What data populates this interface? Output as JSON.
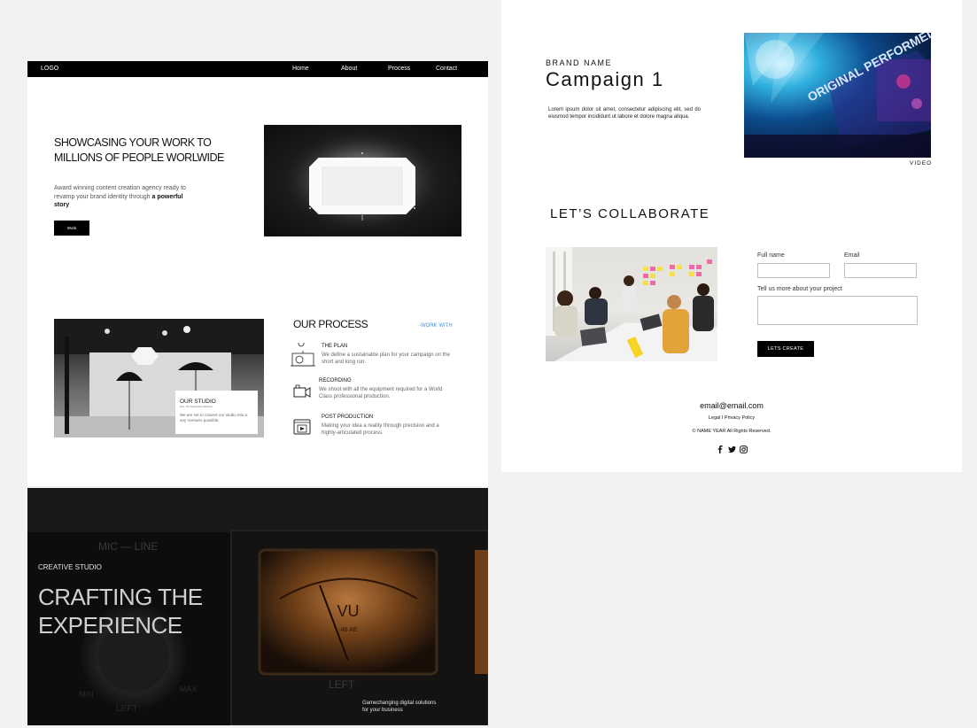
{
  "left_page": {
    "nav": {
      "logo": "LOGO",
      "items": [
        "Home",
        "About",
        "Process",
        "Contact"
      ]
    },
    "hero": {
      "title": "SHOWCASING YOUR WORK TO MILLIONS OF PEOPLE WORLWIDE",
      "desc_plain": "Award winning content creation agency ready to revamp your brand identity through",
      "desc_bold": "a powerful story",
      "button": "Work"
    },
    "studio": {
      "title": "OUR STUDIO",
      "subtitle": "(Ans. The Teleportation Machine)",
      "desc": "We are set to convert our studio into a any scenario possible."
    },
    "process": {
      "title": "OUR PROCESS",
      "link": "-WORK WITH",
      "steps": [
        {
          "title": "THE PLAN",
          "desc": "We define a sustainable plan for your campaign on the short and long run.",
          "icon": "plan-icon"
        },
        {
          "title": "RECORDING",
          "desc": "We shoot with all the equipment required for a World Class professional production.",
          "icon": "camera-icon"
        },
        {
          "title": "POST PRODUCTION",
          "desc": "Making your idea a reality through precision and a highly-articulated process.",
          "icon": "video-player-icon"
        }
      ]
    }
  },
  "dark_panel": {
    "eyebrow": "CREATIVE STUDIO",
    "headline_line1": "CRAFTING THE",
    "headline_line2": "EXPERIENCE",
    "tagline_line1": "Gamechanging digital solutions",
    "tagline_line2": "for your business",
    "meter": {
      "vu": "VU",
      "db": "-48 AE",
      "mic_line": "MIC — LINE",
      "left": "LEFT",
      "min": "MIN",
      "max": "MAX",
      "left_small": "LEFT"
    }
  },
  "right_page": {
    "brand": "BRAND NAME",
    "campaign": "Campaign 1",
    "desc": "Lorem ipsum dolor sit amet, consectetur adipiscing elit, sed do eiusmod tempor incididunt ut labore et dolore magna aliqua.",
    "video_label": "VIDEO",
    "collab_title": "LET’S COLLABORATE",
    "form": {
      "full_name_label": "Full name",
      "email_label": "Email",
      "project_label": "Tell us more about your project",
      "submit": "LETS CREATE"
    },
    "footer": {
      "email": "email@email.com",
      "links": "Legal I Privacy Policy",
      "copyright": "© NAME YEAR All Rights Reserved.",
      "socials": [
        "facebook-icon",
        "twitter-icon",
        "instagram-icon"
      ]
    },
    "concert_sign": "ORIGINAL PERFORMED"
  }
}
